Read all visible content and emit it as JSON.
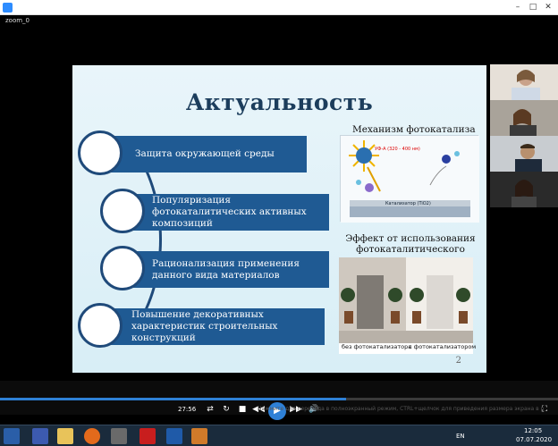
{
  "window": {
    "title": "",
    "subtitle": "zoom_0",
    "minimize": "–",
    "maximize": "□",
    "close": "✕"
  },
  "slide": {
    "title": "Актуальность",
    "items": [
      "Защита окружающей среды",
      "Популяризация фотокаталитических активных композиций",
      "Рационализация применения данного вида материалов",
      "Повышение декоративных характеристик строительных конструкций"
    ],
    "mechanism_title": "Механизм фотокатализа",
    "mechanism_labels": {
      "uv": "УФ-А (320 - 400 нм)",
      "catalyst": "Катализатор (TiO2)"
    },
    "effect_title": "Эффект от использования фотокаталитического материала",
    "caption_left": "без фотокатализатора",
    "caption_right": "с фотокатализатором",
    "page_number": "2"
  },
  "player": {
    "time": "27:56",
    "progress_fraction": 0.62,
    "hint": "Нажмите для перехода в полноэкранный режим, CTRL+щелчок для приведения размера экрана в размер видео"
  },
  "taskbar": {
    "lang": "EN",
    "clock_time": "12:05",
    "clock_date": "07.07.2020"
  },
  "colors": {
    "accent": "#2e80d6",
    "slide_bar": "#1f5a93",
    "title": "#1c3d5c"
  }
}
